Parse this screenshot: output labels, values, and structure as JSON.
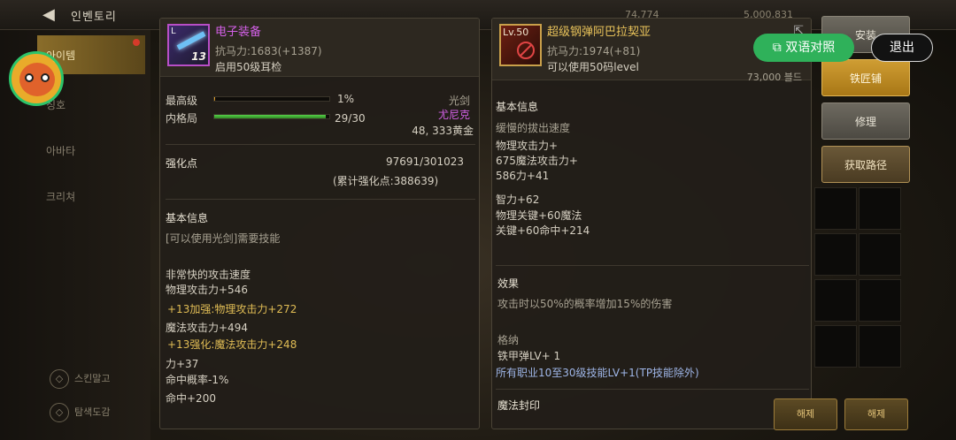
{
  "top": {
    "title": "인벤토리",
    "stat_gold": "5,000,831",
    "stat_count": "74,774"
  },
  "nav": {
    "items": [
      "아이템",
      "칭호",
      "아바타",
      "크리쳐"
    ],
    "bottom": [
      "스킨말고",
      "탐색도감"
    ]
  },
  "left_panel": {
    "name": "电子装备",
    "icon_level": "L",
    "icon_number": "13",
    "stat_line": "抗马力:1683(+1387)",
    "req_line": "启用50级耳检",
    "bar1_label": "最高级",
    "bar1_value": "1%",
    "bar1_fill": 1,
    "bar2_label": "内格局",
    "bar2_value": "29/30",
    "bar2_fill": 96.7,
    "type": "光剑",
    "source": "尤尼克",
    "price": "48, 333黄金",
    "reinforce_label": "强化点",
    "reinforce_value": "97691/301023",
    "reinforce_total": "(累计强化点:388639)",
    "basic_info": "基本信息",
    "usable": "[可以使用光剑]需要技能",
    "attack_speed": "非常快的攻击速度",
    "phys_atk": "物理攻击力+546",
    "bonus1": "+13加强:物理攻击力+272",
    "mag_atk": "魔法攻击力+494",
    "bonus2": "+13强化:魔法攻击力+248",
    "str": "力+37",
    "hit_rate": "命中概率-1%",
    "hit": "命中+200"
  },
  "right_panel": {
    "icon_level": "Lv.50",
    "name": "超级钢弹阿巴拉契亚",
    "stat_line": "抗马力:1974(+81)",
    "req_line": "可以使用50码level",
    "price_partial": "73,000 블드",
    "basic_info": "基本信息",
    "attack_speed": "缓慢的拔出速度",
    "phys_atk": "物理攻击力+",
    "mag_atk": "675魔法攻击力+",
    "str": "586力+41",
    "int": "智力+62",
    "phys_crit": "物理关键+60魔法",
    "crit_hit": "关键+60命中+214",
    "effect_title": "效果",
    "effect_text": "攻击时以50%的概率增加15%的伤害",
    "slot_title": "格纳",
    "slot_line1": "铁甲弹LV+ 1",
    "slot_line2": "所有职业10至30级技能LV+1(TP技能除外)",
    "seal_title": "魔法封印"
  },
  "buttons": {
    "install": "安装",
    "smith": "铁匠铺",
    "repair": "修理",
    "get_path": "获取路径",
    "translate": "双语对照",
    "exit": "退出",
    "bottom1": "해제",
    "bottom2": "해제"
  },
  "colors": {
    "accent_gold": "#cf9d33",
    "unique_purple": "#d260e6",
    "translate_green": "#2fb15a"
  }
}
